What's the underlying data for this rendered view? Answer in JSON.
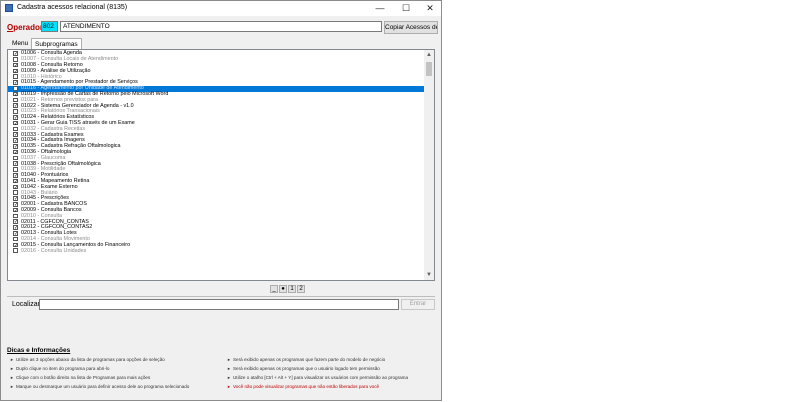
{
  "window": {
    "title": "Cadastra acessos relacional (8135)",
    "minimize": "—",
    "maximize": "☐",
    "close": "✕"
  },
  "operator": {
    "label_prefix": "O",
    "label_rest": "perador",
    "code": "802",
    "name": "ATENDIMENTO",
    "copy_button": "Copiar Acessos de"
  },
  "tabs": [
    {
      "label": "Menu"
    },
    {
      "label": "Subprogramas"
    }
  ],
  "programs": [
    {
      "label": "01006 - Consulta Agenda",
      "checked": true,
      "enabled": true
    },
    {
      "label": "01007 - Consulta Locais de Atendimento",
      "checked": false,
      "enabled": false
    },
    {
      "label": "01008 - Consulta Retorno",
      "checked": true,
      "enabled": true
    },
    {
      "label": "01009 - Análise de Utilização",
      "checked": true,
      "enabled": true
    },
    {
      "label": "01010 - Histórico",
      "checked": false,
      "enabled": false
    },
    {
      "label": "01015 - Agendamento por Prestador de Serviços",
      "checked": true,
      "enabled": true
    },
    {
      "label": "01016 - Agendamento por Unidade de Atendimento",
      "checked": false,
      "enabled": false,
      "selected": true
    },
    {
      "label": "01019 - Impressão de Cartas de Retorno pelo Microsoft Word",
      "checked": true,
      "enabled": true
    },
    {
      "label": "01021 - Retornos previstos para",
      "checked": false,
      "enabled": false
    },
    {
      "label": "01022 - Sistema Gerenciador de Agenda - v1.0",
      "checked": true,
      "enabled": true
    },
    {
      "label": "01023 - Relatórios Transacionais",
      "checked": false,
      "enabled": false
    },
    {
      "label": "01024 - Relatórios Estatísticos",
      "checked": true,
      "enabled": true
    },
    {
      "label": "01031 - Gerar Guia TISS através de um Exame",
      "checked": true,
      "enabled": true
    },
    {
      "label": "01032 - Cadastra Receitas",
      "checked": false,
      "enabled": false
    },
    {
      "label": "01033 - Cadastra Exames",
      "checked": true,
      "enabled": true
    },
    {
      "label": "01034 - Cadastra Imagens",
      "checked": true,
      "enabled": true
    },
    {
      "label": "01035 - Cadastra Refração Oftalmologica",
      "checked": true,
      "enabled": true
    },
    {
      "label": "01036 - Oftalmologia",
      "checked": true,
      "enabled": true
    },
    {
      "label": "01037 - Glaucoma",
      "checked": false,
      "enabled": false
    },
    {
      "label": "01038 - Prescrição Oftalmológica",
      "checked": true,
      "enabled": true
    },
    {
      "label": "01039 - Motilidade",
      "checked": false,
      "enabled": false
    },
    {
      "label": "01040 - Prontuários",
      "checked": true,
      "enabled": true
    },
    {
      "label": "01041 - Mapeamento Retina",
      "checked": true,
      "enabled": true
    },
    {
      "label": "01042 - Exame Externo",
      "checked": true,
      "enabled": true
    },
    {
      "label": "01043 - Bulário",
      "checked": false,
      "enabled": false
    },
    {
      "label": "01045 - Prescrições",
      "checked": true,
      "enabled": true
    },
    {
      "label": "02001 - Cadastra BANCOS",
      "checked": true,
      "enabled": true
    },
    {
      "label": "02009 - Consulta Bancos",
      "checked": true,
      "enabled": true
    },
    {
      "label": "02010 - Consulta",
      "checked": false,
      "enabled": false
    },
    {
      "label": "02011 - CGFCON_CONTAS",
      "checked": true,
      "enabled": true
    },
    {
      "label": "02012 - CGFCON_CONTAS2",
      "checked": true,
      "enabled": true
    },
    {
      "label": "02013 - Consulta Lotes",
      "checked": true,
      "enabled": true
    },
    {
      "label": "02014 - Consulta Movimento",
      "checked": false,
      "enabled": false
    },
    {
      "label": "02015 - Consulta Lançamentos do Financeiro",
      "checked": true,
      "enabled": true
    },
    {
      "label": "02016 - Consulta Unidades",
      "checked": false,
      "enabled": false
    }
  ],
  "pager": [
    "_",
    "●",
    "1",
    "2"
  ],
  "locate": {
    "label": "Localizar:",
    "enter_button": "Entrar"
  },
  "tips": {
    "title": "Dicas e Informações",
    "left": [
      "Utilize as 3 opções abaixo da lista de programas para opções de seleção",
      "Duplo clique no item do programa para abri-lo",
      "Clique com o botão direito na lista de Programas para mais ações",
      "Marque ou desmarque um usuário para definir acesso dele ao programa selecionado"
    ],
    "right": [
      "Será exibido apenas os programas que fazem parte do modelo de negócio",
      "Será exibido apenas os programas que o usuário logado tem permissão",
      "Utilize o atalho [Ctrl + Alt + Y] para visualizar os usuários com permissão ao programa",
      "Você não pode visualizar programas que não estão liberados para você"
    ]
  }
}
